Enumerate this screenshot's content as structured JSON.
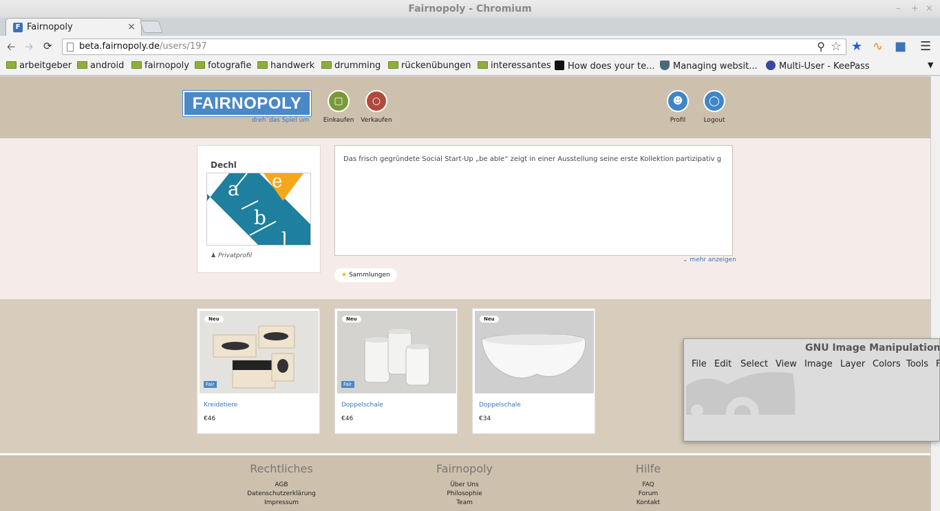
{
  "window": {
    "title": "Fairnopoly - Chromium",
    "controls": [
      "–",
      "+",
      "×"
    ]
  },
  "tab": {
    "label": "Fairnopoly",
    "favicon_letter": "F",
    "close": "×"
  },
  "address": {
    "host": "beta.fairnopoly.de",
    "path": "/users/197"
  },
  "bookmarks": [
    {
      "label": "arbeitgeber",
      "type": "folder"
    },
    {
      "label": "android",
      "type": "folder"
    },
    {
      "label": "fairnopoly",
      "type": "folder"
    },
    {
      "label": "fotografie",
      "type": "folder"
    },
    {
      "label": "handwerk",
      "type": "folder"
    },
    {
      "label": "drumming",
      "type": "folder"
    },
    {
      "label": "rückenübungen",
      "type": "folder"
    },
    {
      "label": "interessantes",
      "type": "folder"
    },
    {
      "label": "How does your te...",
      "type": "page"
    },
    {
      "label": "Managing websit...",
      "type": "page"
    },
    {
      "label": "Multi-User - KeePass",
      "type": "page"
    }
  ],
  "site": {
    "logo": "FAIRNOPOLY",
    "tagline": "dreh`das Spiel um",
    "nav": {
      "buy": "Einkaufen",
      "sell": "Verkaufen",
      "profile": "Profil",
      "logout": "Logout"
    }
  },
  "profile": {
    "name": "Dechl",
    "type": "Privatprofil",
    "logo_letters": {
      "a": "a",
      "e": "e",
      "b": "b",
      "l": "l"
    },
    "description": "Das frisch gegründete Social Start-Up „be able“ zeigt in einer Ausstellung seine erste Kollektion partizipativ g",
    "more": "mehr anzeigen",
    "collections": "Sammlungen"
  },
  "badges": {
    "new": "Neu",
    "fair": "Fair"
  },
  "products": [
    {
      "title": "Kreidetiere",
      "price": "€46",
      "fair": true
    },
    {
      "title": "Doppelschale",
      "price": "€46",
      "fair": true
    },
    {
      "title": "Doppelschale",
      "price": "€34",
      "fair": false
    }
  ],
  "footer": {
    "legal": {
      "title": "Rechtliches",
      "links": [
        "AGB",
        "Datenschutzerklärung",
        "Impressum"
      ]
    },
    "about": {
      "title": "Fairnopoly",
      "links": [
        "Über Uns",
        "Philosophie",
        "Team"
      ]
    },
    "help": {
      "title": "Hilfe",
      "links": [
        "FAQ",
        "Forum",
        "Kontakt"
      ]
    }
  },
  "gimp": {
    "title": "GNU Image Manipulation Program",
    "menu": [
      "File",
      "Edit",
      "Select",
      "View",
      "Image",
      "Layer",
      "Colors",
      "Tools",
      "F"
    ]
  },
  "colors": {
    "brand_blue": "#4b88c6",
    "buy_green": "#7a9a3a",
    "sell_red": "#b04a3c",
    "header_bg": "#cdc0ac"
  }
}
